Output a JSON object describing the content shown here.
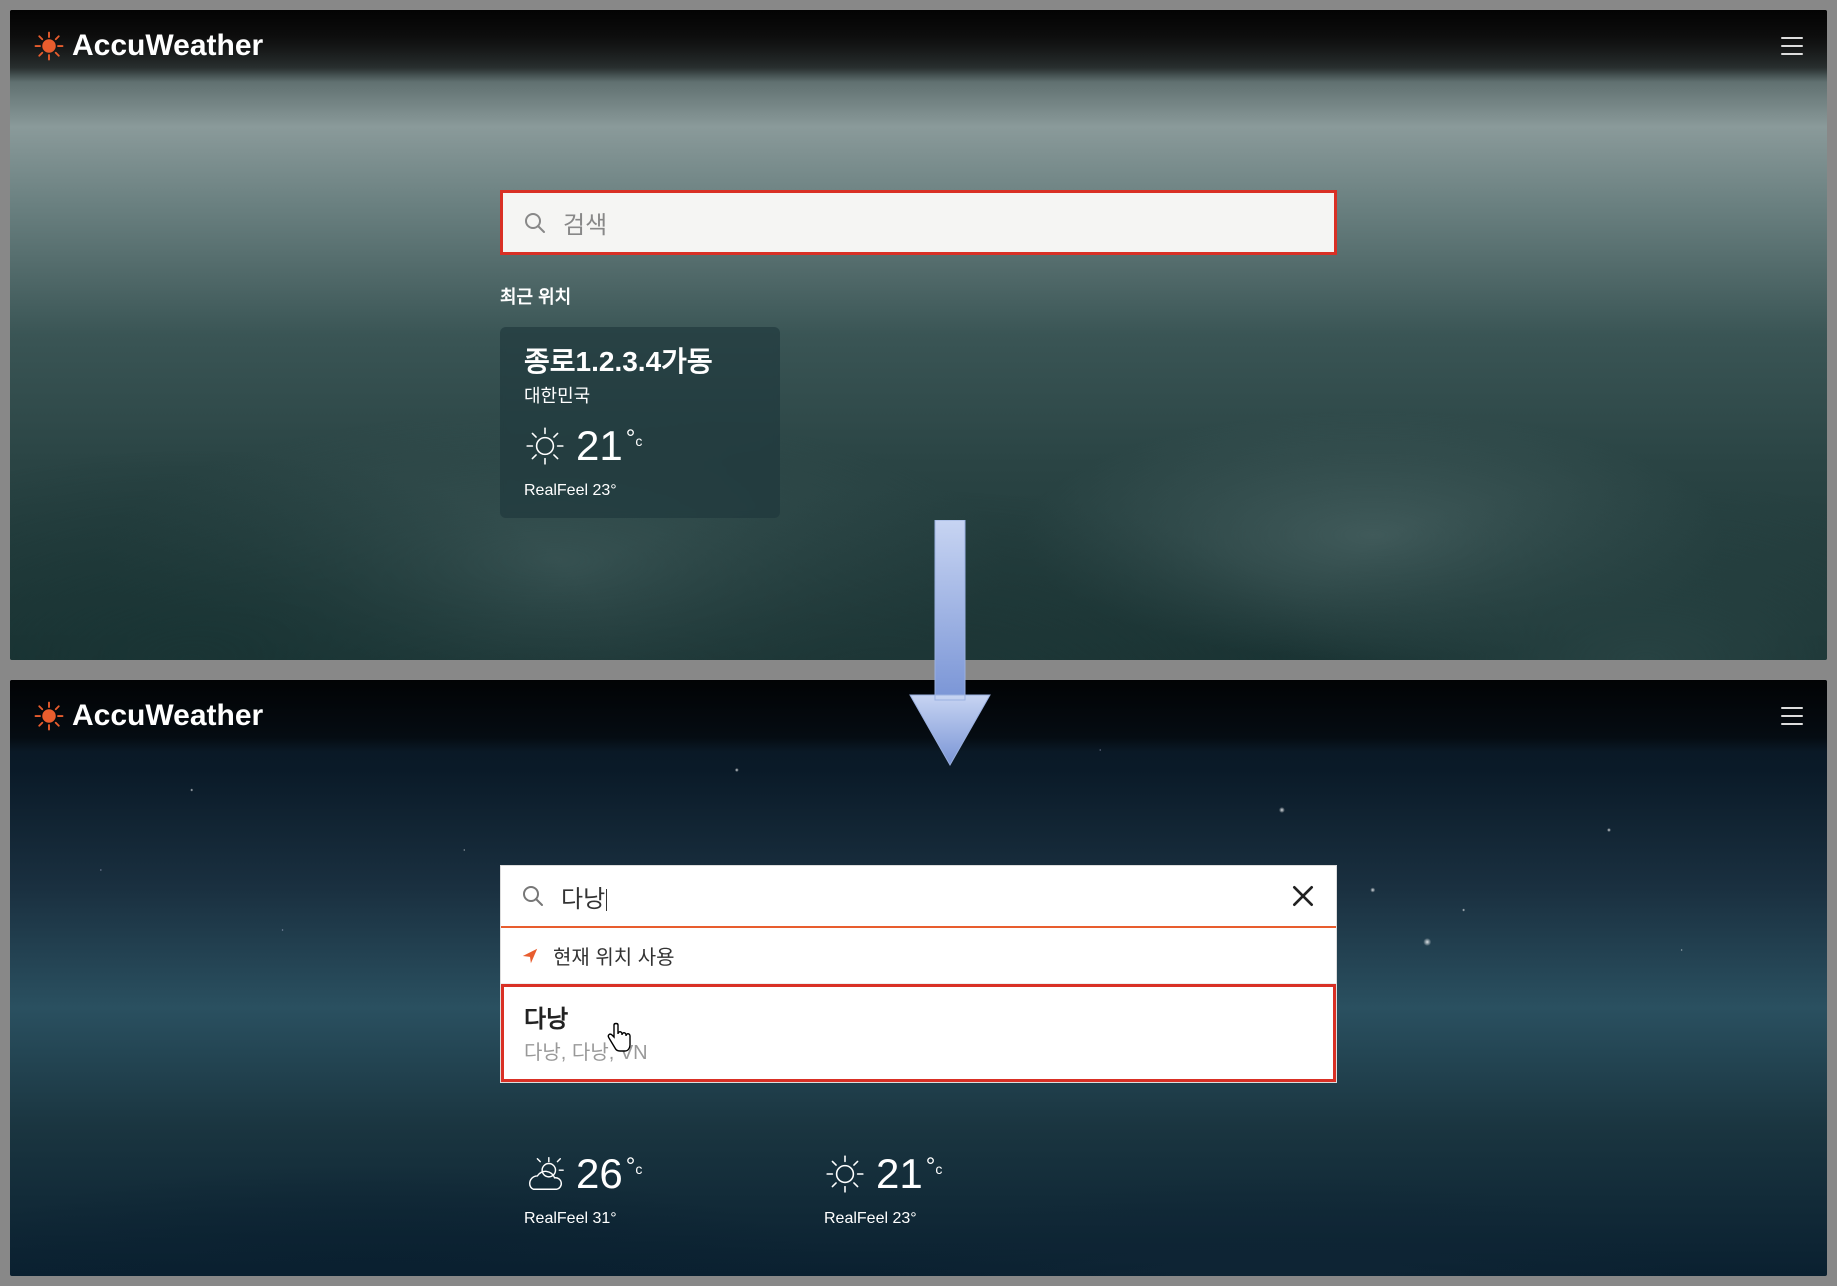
{
  "brand": "AccuWeather",
  "colors": {
    "accent": "#e85d2e",
    "highlight_border": "#d93025"
  },
  "top": {
    "search": {
      "placeholder": "검색"
    },
    "recent_label": "최근 위치",
    "card": {
      "location": "종로1.2.3.4가동",
      "country": "대한민국",
      "temp": "21",
      "unit": "c",
      "realfeel": "RealFeel 23°",
      "icon": "sun"
    }
  },
  "bottom": {
    "search": {
      "value": "다낭",
      "use_current_location": "현재 위치 사용",
      "result": {
        "name": "다낭",
        "sub": "다낭, 다낭, VN"
      }
    },
    "cards": [
      {
        "temp": "26",
        "unit": "c",
        "realfeel": "RealFeel 31°",
        "icon": "partly-cloudy"
      },
      {
        "temp": "21",
        "unit": "c",
        "realfeel": "RealFeel 23°",
        "icon": "sun"
      }
    ]
  }
}
